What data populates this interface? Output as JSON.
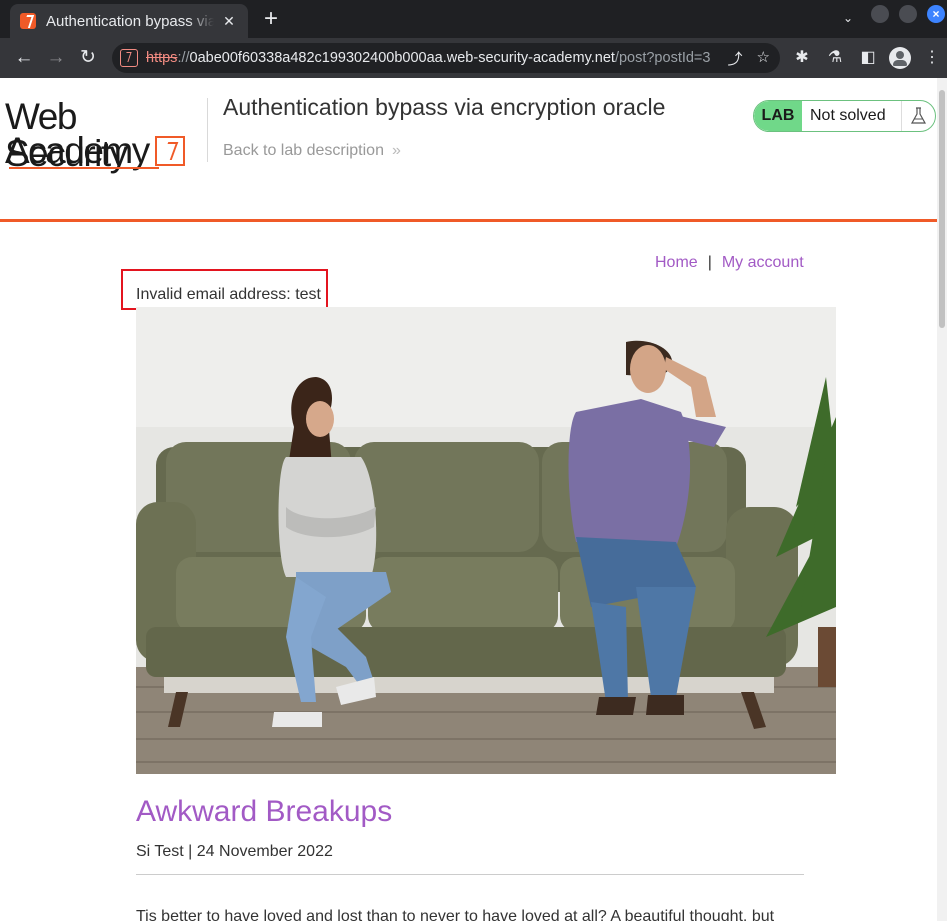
{
  "browser": {
    "tab_title": "Authentication bypass via encryption oracle",
    "url_scheme": "https",
    "url_sep": "://",
    "url_host": "0abe00f60338a482c199302400b000aa.web-security-academy.net",
    "url_path": "/post?postId=3",
    "icons": [
      "lab-favicon-icon",
      "close-icon",
      "new-tab-icon",
      "chevron-down-icon",
      "back-arrow-icon",
      "forward-arrow-icon",
      "reload-icon",
      "not-secure-icon",
      "share-icon",
      "star-icon",
      "extensions-icon",
      "flask-icon",
      "sidebar-icon",
      "profile-avatar-icon",
      "kebab-menu-icon"
    ]
  },
  "header": {
    "logo_line1": "Web Security",
    "logo_line2": "Academy",
    "lab_title": "Authentication bypass via encryption oracle",
    "back_link": "Back to lab description",
    "back_arrows": "»",
    "lab_badge": "LAB",
    "lab_status": "Not solved"
  },
  "nav": {
    "home": "Home",
    "separator": "|",
    "my_account": "My account"
  },
  "notice": {
    "error_text": "Invalid email address: test"
  },
  "post": {
    "title": "Awkward Breakups",
    "meta": "Si Test | 24 November 2022",
    "body": "Tis better to have loved and lost than to never to have loved at all? A beautiful thought, but"
  },
  "colors": {
    "accent_orange": "#f05a28",
    "link_purple": "#a25ac5",
    "lab_green": "#70d889",
    "error_red": "#e3141f"
  }
}
